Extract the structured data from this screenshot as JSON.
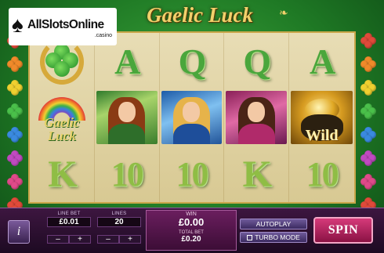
{
  "logo": {
    "symbol": "♠",
    "text": "AllSlotsOnline",
    "sub": ".casino"
  },
  "game": {
    "title": "Gaelic Luck"
  },
  "reels": [
    [
      {
        "type": "image",
        "name": "clover-horseshoe"
      },
      {
        "type": "letter",
        "text": "A"
      },
      {
        "type": "letter",
        "text": "Q"
      },
      {
        "type": "letter",
        "text": "Q"
      },
      {
        "type": "letter",
        "text": "A"
      }
    ],
    [
      {
        "type": "logo",
        "text_line1": "Gaelic",
        "text_line2": "Luck"
      },
      {
        "type": "image",
        "name": "green-hat-girl"
      },
      {
        "type": "image",
        "name": "blue-dress-girl"
      },
      {
        "type": "image",
        "name": "pink-dress-girl"
      },
      {
        "type": "wild",
        "text": "Wild"
      }
    ],
    [
      {
        "type": "letter",
        "text": "K"
      },
      {
        "type": "letter",
        "text": "10"
      },
      {
        "type": "letter",
        "text": "10"
      },
      {
        "type": "letter",
        "text": "K"
      },
      {
        "type": "letter",
        "text": "10"
      }
    ]
  ],
  "controls": {
    "info_label": "i",
    "line_bet": {
      "label": "LINE BET",
      "value": "£0.01"
    },
    "lines": {
      "label": "LINES",
      "value": "20"
    },
    "minus": "–",
    "plus": "+",
    "win": {
      "label": "WIN",
      "value": "£0.00"
    },
    "total_bet": {
      "label": "TOTAL BET",
      "value": "£0.20"
    },
    "autoplay": "AUTOPLAY",
    "turbo": "TURBO MODE",
    "spin": "SPIN"
  },
  "colors": {
    "background": "#2a8a2e",
    "reel_bg": "#e4d8ac",
    "letters": "#4aa63c",
    "bar": "#2e1032",
    "spin": "#c0306a"
  }
}
